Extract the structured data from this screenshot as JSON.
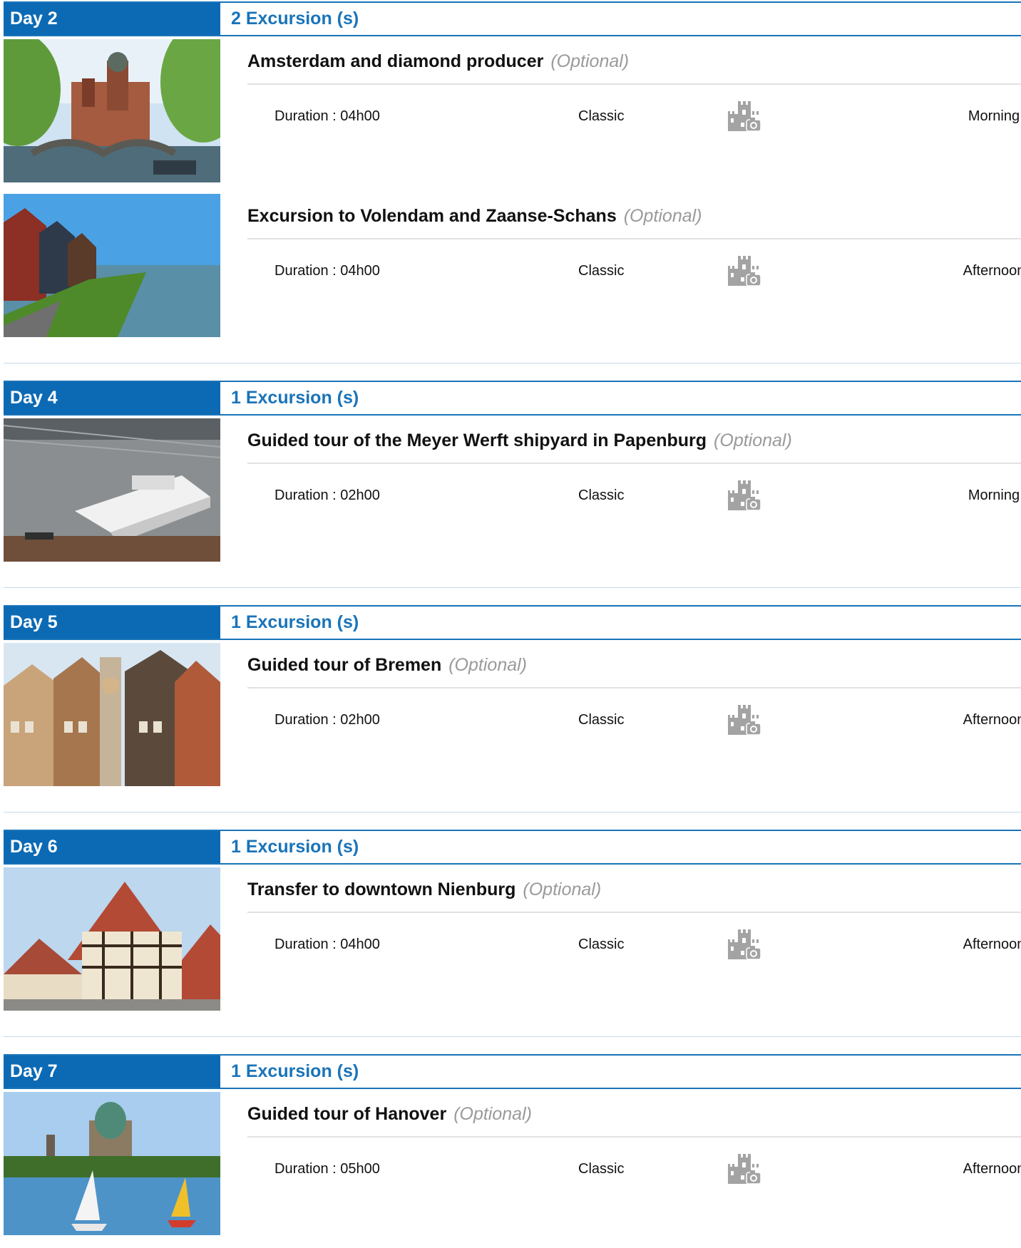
{
  "colors": {
    "accent": "#0c6ab4",
    "optional": "#9a9a9a"
  },
  "optional_label": "(Optional)",
  "days": [
    {
      "label": "Day 2",
      "count": "2 Excursion (s)",
      "excursions": [
        {
          "title": "Amsterdam and diamond producer",
          "optional": "(Optional)",
          "duration": "Duration : 04h00",
          "category": "Classic",
          "icon": "castle-camera-icon",
          "period": "Morning",
          "photo": "amsterdam-canal-photo"
        },
        {
          "title": "Excursion to Volendam and Zaanse-Schans",
          "optional": "(Optional)",
          "duration": "Duration : 04h00",
          "category": "Classic",
          "icon": "castle-camera-icon",
          "period": "Afternoon",
          "photo": "volendam-waterfront-photo"
        }
      ]
    },
    {
      "label": "Day 4",
      "count": "1 Excursion (s)",
      "excursions": [
        {
          "title": "Guided tour of the Meyer Werft shipyard in Papenburg",
          "optional": "(Optional)",
          "duration": "Duration : 02h00",
          "category": "Classic",
          "icon": "castle-camera-icon",
          "period": "Morning",
          "photo": "shipyard-photo"
        }
      ]
    },
    {
      "label": "Day 5",
      "count": "1 Excursion (s)",
      "excursions": [
        {
          "title": "Guided tour of Bremen",
          "optional": "(Optional)",
          "duration": "Duration : 02h00",
          "category": "Classic",
          "icon": "castle-camera-icon",
          "period": "Afternoon",
          "photo": "bremen-square-photo"
        }
      ]
    },
    {
      "label": "Day 6",
      "count": "1 Excursion (s)",
      "excursions": [
        {
          "title": "Transfer to downtown Nienburg",
          "optional": "(Optional)",
          "duration": "Duration : 04h00",
          "category": "Classic",
          "icon": "castle-camera-icon",
          "period": "Afternoon",
          "photo": "nienburg-timber-house-photo"
        }
      ]
    },
    {
      "label": "Day 7",
      "count": "1 Excursion (s)",
      "excursions": [
        {
          "title": "Guided tour of Hanover",
          "optional": "(Optional)",
          "duration": "Duration : 05h00",
          "category": "Classic",
          "icon": "castle-camera-icon",
          "period": "Afternoon",
          "photo": "hanover-lake-photo"
        }
      ]
    }
  ]
}
